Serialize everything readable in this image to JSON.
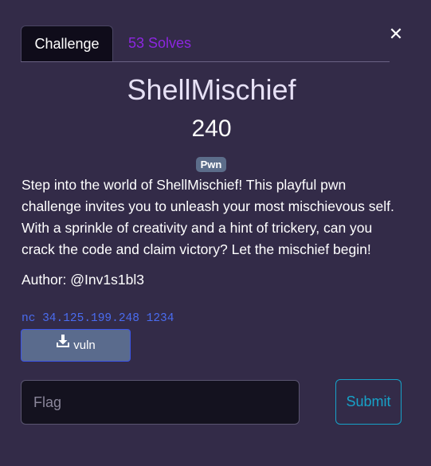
{
  "close_icon": "close-icon",
  "tabs": [
    {
      "label": "Challenge",
      "active": true
    },
    {
      "label": "53 Solves",
      "active": false
    }
  ],
  "challenge": {
    "name": "ShellMischief",
    "value": "240",
    "category": "Pwn",
    "description": "Step into the world of ShellMischief! This playful pwn challenge invites you to unleash your most mischievous self. With a sprinkle of creativity and a hint of trickery, can you crack the code and claim victory? Let the mischief begin!",
    "author": "Author: @Inv1s1bl3",
    "connection_info": "nc 34.125.199.248 1234",
    "file": {
      "label": "vuln",
      "icon": "download-icon"
    }
  },
  "form": {
    "flag_placeholder": "Flag",
    "submit_label": "Submit"
  },
  "colors": {
    "background": "#332b48",
    "solves_tab": "#8c26e0",
    "badge": "#5c6d8a",
    "connection": "#4a6cf0",
    "submit": "#17a2c8"
  }
}
